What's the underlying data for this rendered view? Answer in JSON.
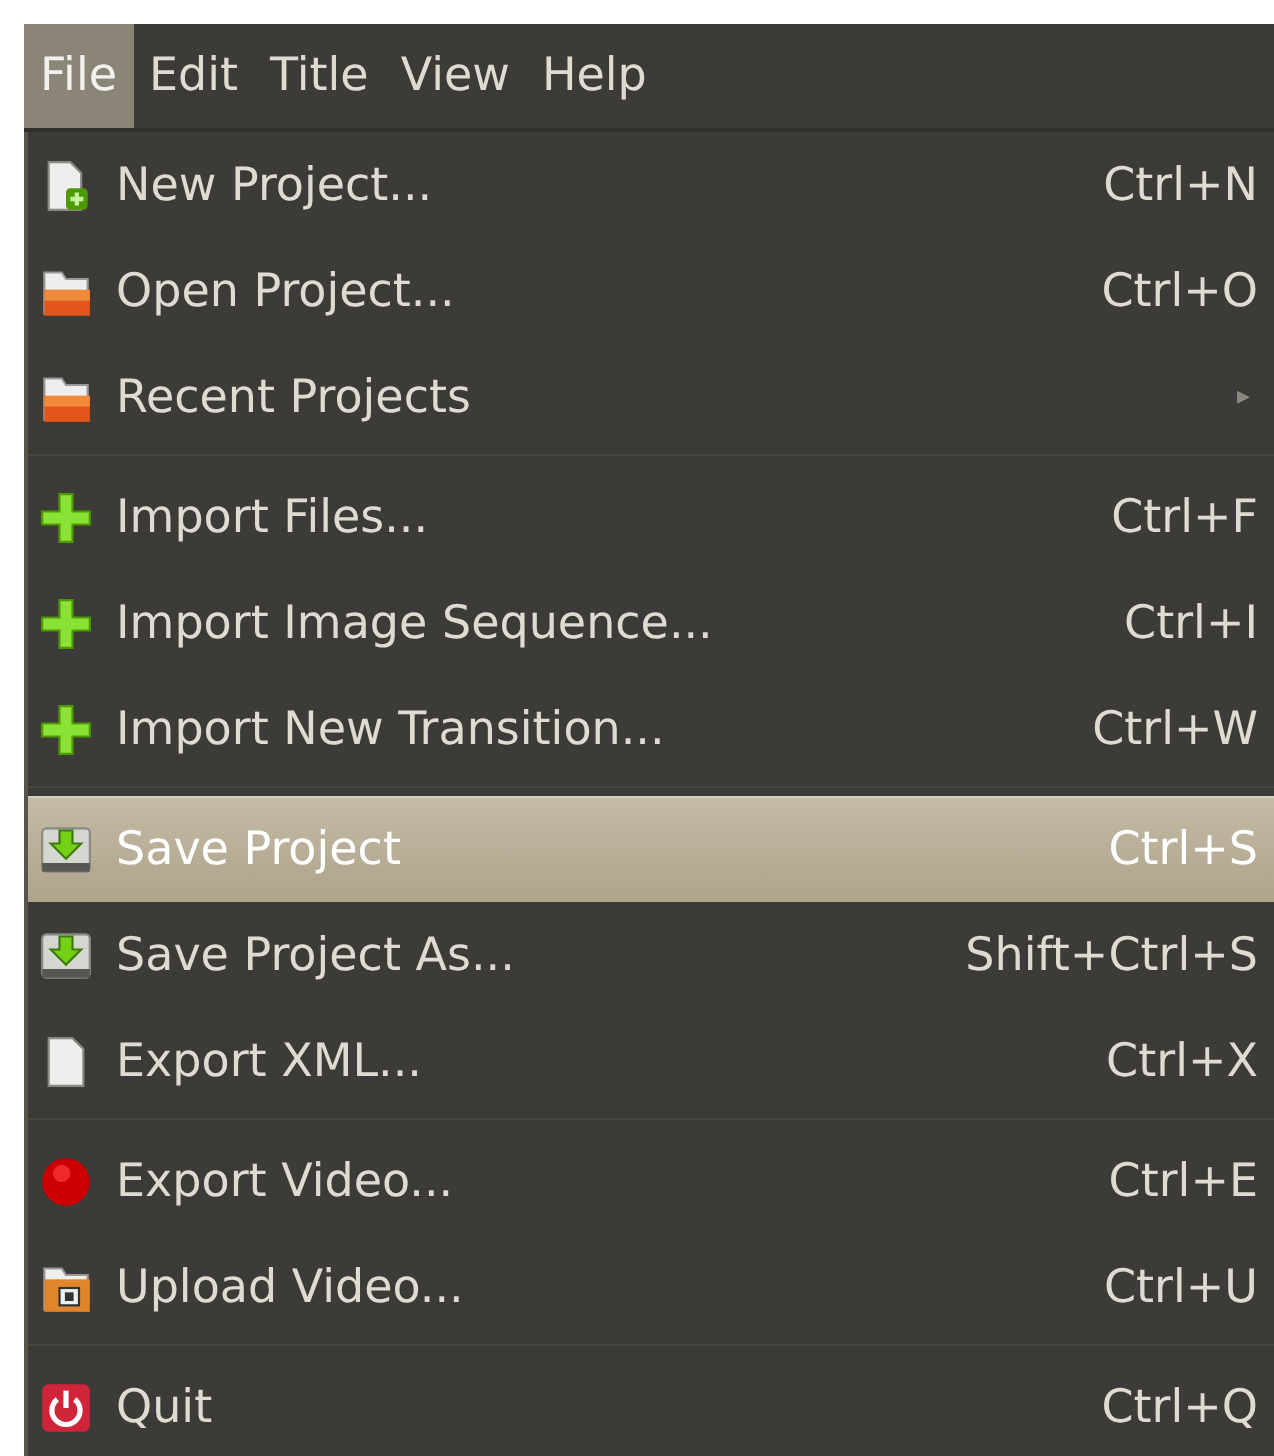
{
  "menubar": [
    {
      "label": "File",
      "selected": true
    },
    {
      "label": "Edit",
      "selected": false
    },
    {
      "label": "Title",
      "selected": false
    },
    {
      "label": "View",
      "selected": false
    },
    {
      "label": "Help",
      "selected": false
    }
  ],
  "menu": {
    "groups": [
      [
        {
          "kind": "new-document",
          "label": "New Project...",
          "shortcut": "Ctrl+N",
          "selected": false
        },
        {
          "kind": "folder",
          "label": "Open Project...",
          "shortcut": "Ctrl+O",
          "selected": false
        },
        {
          "kind": "folder",
          "label": "Recent Projects",
          "submenu": "▸",
          "selected": false
        }
      ],
      [
        {
          "kind": "plus",
          "label": "Import Files...",
          "shortcut": "Ctrl+F",
          "selected": false
        },
        {
          "kind": "plus",
          "label": "Import Image Sequence...",
          "shortcut": "Ctrl+I",
          "selected": false
        },
        {
          "kind": "plus",
          "label": "Import New Transition...",
          "shortcut": "Ctrl+W",
          "selected": false
        }
      ],
      [
        {
          "kind": "save",
          "label": "Save Project",
          "shortcut": "Ctrl+S",
          "selected": true
        },
        {
          "kind": "save",
          "label": "Save Project As...",
          "shortcut": "Shift+Ctrl+S",
          "selected": false
        },
        {
          "kind": "document",
          "label": "Export XML...",
          "shortcut": "Ctrl+X",
          "selected": false
        }
      ],
      [
        {
          "kind": "record",
          "label": "Export Video...",
          "shortcut": "Ctrl+E",
          "selected": false
        },
        {
          "kind": "upload",
          "label": "Upload Video...",
          "shortcut": "Ctrl+U",
          "selected": false
        }
      ],
      [
        {
          "kind": "power",
          "label": "Quit",
          "shortcut": "Ctrl+Q",
          "selected": false
        }
      ]
    ]
  }
}
